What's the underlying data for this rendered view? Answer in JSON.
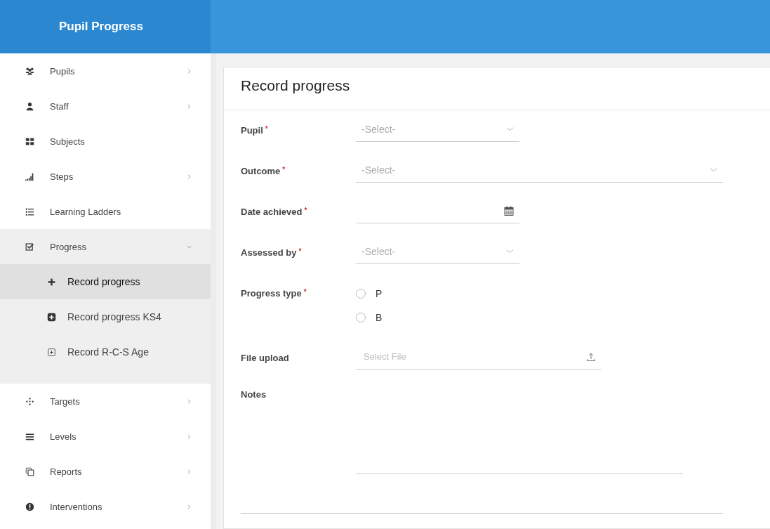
{
  "app_title": "Pupil Progress",
  "sidebar": {
    "items": [
      {
        "label": "Pupils",
        "has_arrow": true,
        "expanded": false
      },
      {
        "label": "Staff",
        "has_arrow": true,
        "expanded": false
      },
      {
        "label": "Subjects",
        "has_arrow": false,
        "expanded": false
      },
      {
        "label": "Steps",
        "has_arrow": true,
        "expanded": false
      },
      {
        "label": "Learning Ladders",
        "has_arrow": false,
        "expanded": false
      },
      {
        "label": "Progress",
        "has_arrow": true,
        "expanded": true,
        "children": [
          {
            "label": "Record progress",
            "selected": true
          },
          {
            "label": "Record progress KS4",
            "selected": false
          },
          {
            "label": "Record R-C-S Age",
            "selected": false
          }
        ]
      },
      {
        "label": "Targets",
        "has_arrow": true,
        "expanded": false
      },
      {
        "label": "Levels",
        "has_arrow": true,
        "expanded": false
      },
      {
        "label": "Reports",
        "has_arrow": true,
        "expanded": false
      },
      {
        "label": "Interventions",
        "has_arrow": true,
        "expanded": false
      }
    ]
  },
  "card": {
    "title": "Record progress",
    "fields": [
      {
        "kind": "select",
        "label": "Pupil",
        "required_mark": "*",
        "placeholder": "-Select-"
      },
      {
        "kind": "select",
        "label": "Outcome",
        "required_mark": "*",
        "placeholder": "-Select-"
      },
      {
        "kind": "date",
        "label": "Date achieved",
        "required_mark": "*"
      },
      {
        "kind": "select",
        "label": "Assessed by",
        "required_mark": "*",
        "placeholder": "-Select-"
      },
      {
        "kind": "radio",
        "label": "Progress type",
        "required_mark": "*",
        "options": [
          {
            "label": "P",
            "selected": false
          },
          {
            "label": "B",
            "selected": false
          }
        ]
      },
      {
        "kind": "file",
        "label": "File upload",
        "placeholder": "Select File"
      },
      {
        "kind": "textarea",
        "label": "Notes"
      }
    ]
  }
}
